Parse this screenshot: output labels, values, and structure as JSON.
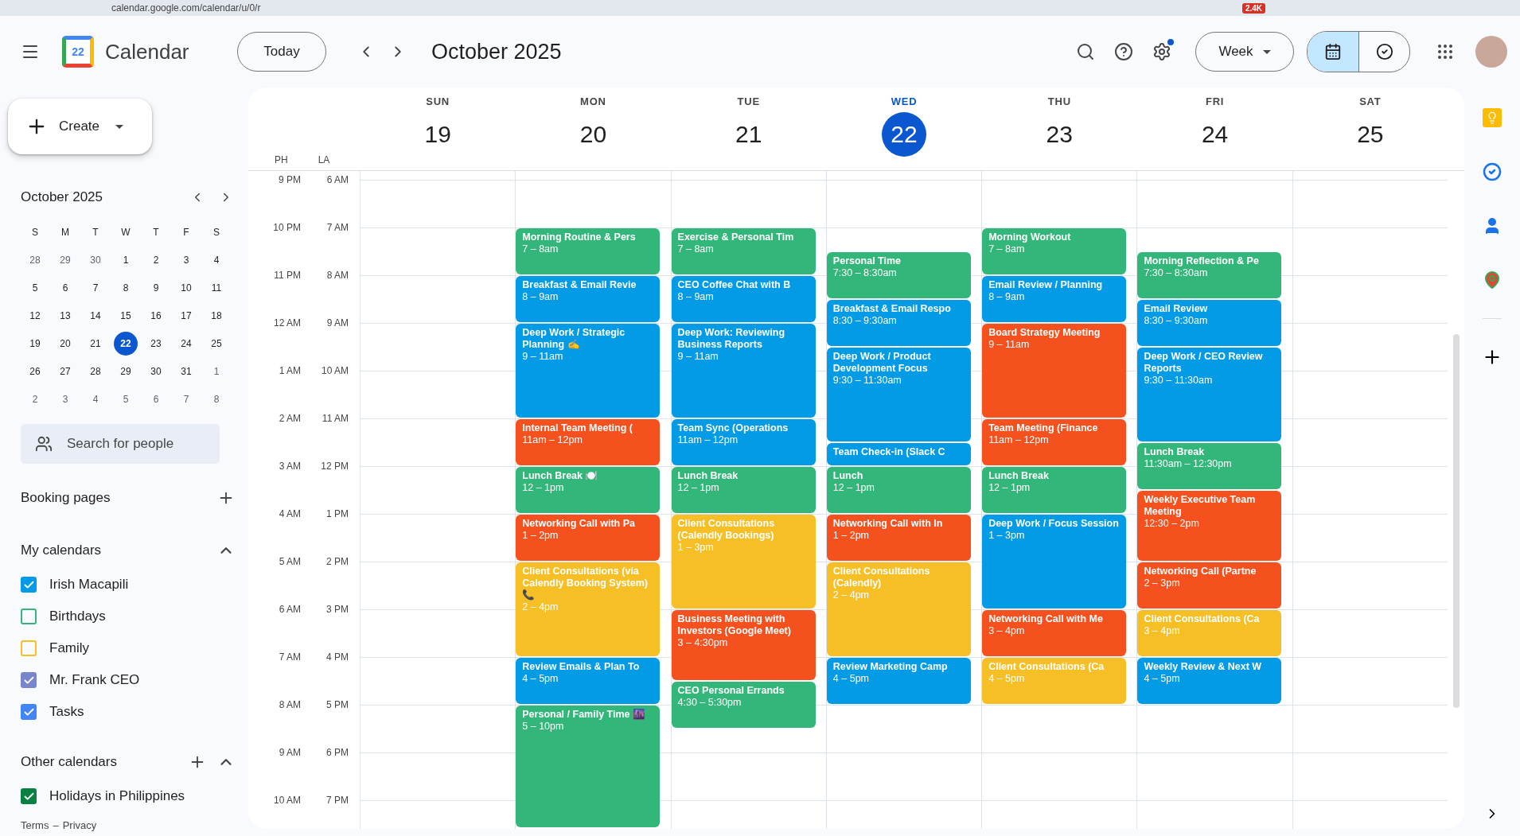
{
  "browser": {
    "url": "calendar.google.com/calendar/u/0/r",
    "badge": "2.4K"
  },
  "header": {
    "logo_text": "22",
    "app_name": "Calendar",
    "today_button": "Today",
    "period": "October 2025",
    "settings_badge": true,
    "view_button": "Week",
    "view_toggle": [
      {
        "kind": "calendar",
        "selected": true
      },
      {
        "kind": "tasks",
        "selected": false
      }
    ]
  },
  "sidebar": {
    "create": "Create",
    "mini_calendar": {
      "title": "October 2025",
      "weekdays": [
        "S",
        "M",
        "T",
        "W",
        "T",
        "F",
        "S"
      ],
      "weeks": [
        [
          {
            "day": "28",
            "outside": true,
            "selected": false
          },
          {
            "day": "29",
            "outside": true,
            "selected": false
          },
          {
            "day": "30",
            "outside": true,
            "selected": false
          },
          {
            "day": "1",
            "outside": false,
            "selected": false
          },
          {
            "day": "2",
            "outside": false,
            "selected": false
          },
          {
            "day": "3",
            "outside": false,
            "selected": false
          },
          {
            "day": "4",
            "outside": false,
            "selected": false
          }
        ],
        [
          {
            "day": "5",
            "outside": false,
            "selected": false
          },
          {
            "day": "6",
            "outside": false,
            "selected": false
          },
          {
            "day": "7",
            "outside": false,
            "selected": false
          },
          {
            "day": "8",
            "outside": false,
            "selected": false
          },
          {
            "day": "9",
            "outside": false,
            "selected": false
          },
          {
            "day": "10",
            "outside": false,
            "selected": false
          },
          {
            "day": "11",
            "outside": false,
            "selected": false
          }
        ],
        [
          {
            "day": "12",
            "outside": false,
            "selected": false
          },
          {
            "day": "13",
            "outside": false,
            "selected": false
          },
          {
            "day": "14",
            "outside": false,
            "selected": false
          },
          {
            "day": "15",
            "outside": false,
            "selected": false
          },
          {
            "day": "16",
            "outside": false,
            "selected": false
          },
          {
            "day": "17",
            "outside": false,
            "selected": false
          },
          {
            "day": "18",
            "outside": false,
            "selected": false
          }
        ],
        [
          {
            "day": "19",
            "outside": false,
            "selected": false
          },
          {
            "day": "20",
            "outside": false,
            "selected": false
          },
          {
            "day": "21",
            "outside": false,
            "selected": false
          },
          {
            "day": "22",
            "outside": false,
            "selected": true
          },
          {
            "day": "23",
            "outside": false,
            "selected": false
          },
          {
            "day": "24",
            "outside": false,
            "selected": false
          },
          {
            "day": "25",
            "outside": false,
            "selected": false
          }
        ],
        [
          {
            "day": "26",
            "outside": false,
            "selected": false
          },
          {
            "day": "27",
            "outside": false,
            "selected": false
          },
          {
            "day": "28",
            "outside": false,
            "selected": false
          },
          {
            "day": "29",
            "outside": false,
            "selected": false
          },
          {
            "day": "30",
            "outside": false,
            "selected": false
          },
          {
            "day": "31",
            "outside": false,
            "selected": false
          },
          {
            "day": "1",
            "outside": true,
            "selected": false
          }
        ],
        [
          {
            "day": "2",
            "outside": true,
            "selected": false
          },
          {
            "day": "3",
            "outside": true,
            "selected": false
          },
          {
            "day": "4",
            "outside": true,
            "selected": false
          },
          {
            "day": "5",
            "outside": true,
            "selected": false
          },
          {
            "day": "6",
            "outside": true,
            "selected": false
          },
          {
            "day": "7",
            "outside": true,
            "selected": false
          },
          {
            "day": "8",
            "outside": true,
            "selected": false
          }
        ]
      ]
    },
    "people_search": {
      "placeholder": "Search for people"
    },
    "booking_pages": "Booking pages",
    "my_calendars": {
      "title": "My calendars",
      "expanded": true,
      "items": [
        {
          "name": "Irish Macapili",
          "checked": true,
          "color": "#039be5"
        },
        {
          "name": "Birthdays",
          "checked": false,
          "color": "#33b679"
        },
        {
          "name": "Family",
          "checked": false,
          "color": "#f6bf26"
        },
        {
          "name": "Mr. Frank CEO",
          "checked": true,
          "color": "#7986cb"
        },
        {
          "name": "Tasks",
          "checked": true,
          "color": "#4285f4"
        }
      ]
    },
    "other_calendars": {
      "title": "Other calendars",
      "expanded": true,
      "items": [
        {
          "name": "Holidays in Philippines",
          "checked": true,
          "color": "#0b8043"
        }
      ]
    },
    "footer": {
      "links": [
        "Terms",
        "Privacy"
      ],
      "separator": "–"
    }
  },
  "week": {
    "timezones": [
      "PH",
      "LA"
    ],
    "hours": [
      {
        "ph": "9 PM",
        "la": "6 AM"
      },
      {
        "ph": "10 PM",
        "la": "7 AM"
      },
      {
        "ph": "11 PM",
        "la": "8 AM"
      },
      {
        "ph": "12 AM",
        "la": "9 AM"
      },
      {
        "ph": "1 AM",
        "la": "10 AM"
      },
      {
        "ph": "2 AM",
        "la": "11 AM"
      },
      {
        "ph": "3 AM",
        "la": "12 PM"
      },
      {
        "ph": "4 AM",
        "la": "1 PM"
      },
      {
        "ph": "5 AM",
        "la": "2 PM"
      },
      {
        "ph": "6 AM",
        "la": "3 PM"
      },
      {
        "ph": "7 AM",
        "la": "4 PM"
      },
      {
        "ph": "8 AM",
        "la": "5 PM"
      },
      {
        "ph": "9 AM",
        "la": "6 PM"
      },
      {
        "ph": "10 AM",
        "la": "7 PM"
      }
    ],
    "days": [
      {
        "name": "SUN",
        "date": "19",
        "today": false
      },
      {
        "name": "MON",
        "date": "20",
        "today": false,
        "events": [
          {
            "title": "Morning Routine & Pers",
            "time": "7 – 8am",
            "color": "#33b679"
          },
          {
            "title": "Breakfast & Email Revie",
            "time": "8 – 9am",
            "color": "#039be5"
          },
          {
            "title": "Deep Work / Strategic Planning ✍️",
            "time": "9 – 11am",
            "color": "#039be5"
          },
          {
            "title": "Internal Team Meeting (",
            "time": "11am – 12pm",
            "color": "#f4511e"
          },
          {
            "title": "Lunch Break 🍽️",
            "time": "12 – 1pm",
            "color": "#33b679"
          },
          {
            "title": "Networking Call with Pa",
            "time": "1 – 2pm",
            "color": "#f4511e"
          },
          {
            "title": "Client Consultations (via Calendly Booking System) 📞",
            "time": "2 – 4pm",
            "color": "#f6bf26"
          },
          {
            "title": "Review Emails & Plan To",
            "time": "4 – 5pm",
            "color": "#039be5"
          },
          {
            "title": "Personal / Family Time 🌆",
            "time": "5 – 10pm",
            "color": "#33b679"
          }
        ]
      },
      {
        "name": "TUE",
        "date": "21",
        "today": false,
        "events": [
          {
            "title": "Exercise & Personal Tim",
            "time": "7 – 8am",
            "color": "#33b679"
          },
          {
            "title": "CEO Coffee Chat with B",
            "time": "8 – 9am",
            "color": "#039be5"
          },
          {
            "title": "Deep Work: Reviewing Business Reports",
            "time": "9 – 11am",
            "color": "#039be5"
          },
          {
            "title": "Team Sync (Operations",
            "time": "11am – 12pm",
            "color": "#039be5"
          },
          {
            "title": "Lunch Break",
            "time": "12 – 1pm",
            "color": "#33b679"
          },
          {
            "title": "Client Consultations (Calendly Bookings)",
            "time": "1 – 3pm",
            "color": "#f6bf26"
          },
          {
            "title": "Business Meeting with Investors (Google Meet)",
            "time": "3 – 4:30pm",
            "color": "#f4511e"
          },
          {
            "title": "CEO Personal Errands",
            "time": "4:30 – 5:30pm",
            "color": "#33b679"
          }
        ]
      },
      {
        "name": "WED",
        "date": "22",
        "today": true,
        "events": [
          {
            "title": "Personal Time",
            "time": "7:30 – 8:30am",
            "color": "#33b679"
          },
          {
            "title": "Breakfast & Email Respo",
            "time": "8:30 – 9:30am",
            "color": "#039be5"
          },
          {
            "title": "Deep Work / Product Development Focus",
            "time": "9:30 – 11:30am",
            "color": "#039be5"
          },
          {
            "title": "Team Check-in (Slack C",
            "color": "#039be5"
          },
          {
            "title": "Lunch",
            "time": "12 – 1pm",
            "color": "#33b679"
          },
          {
            "title": "Networking Call with In",
            "time": "1 – 2pm",
            "color": "#f4511e"
          },
          {
            "title": "Client Consultations (Calendly)",
            "time": "2 – 4pm",
            "color": "#f6bf26"
          },
          {
            "title": "Review Marketing Camp",
            "time": "4 – 5pm",
            "color": "#039be5"
          }
        ]
      },
      {
        "name": "THU",
        "date": "23",
        "today": false,
        "events": [
          {
            "title": "Morning Workout",
            "time": "7 – 8am",
            "color": "#33b679"
          },
          {
            "title": "Email Review / Planning",
            "time": "8 – 9am",
            "color": "#039be5"
          },
          {
            "title": "Board Strategy Meeting",
            "time": "9 – 11am",
            "color": "#f4511e"
          },
          {
            "title": "Team Meeting (Finance",
            "time": "11am – 12pm",
            "color": "#f4511e"
          },
          {
            "title": "Lunch Break",
            "time": "12 – 1pm",
            "color": "#33b679"
          },
          {
            "title": "Deep Work / Focus Session",
            "time": "1 – 3pm",
            "color": "#039be5"
          },
          {
            "title": "Networking Call with Me",
            "time": "3 – 4pm",
            "color": "#f4511e"
          },
          {
            "title": "Client Consultations (Ca",
            "time": "4 – 5pm",
            "color": "#f6bf26"
          }
        ]
      },
      {
        "name": "FRI",
        "date": "24",
        "today": false,
        "events": [
          {
            "title": "Morning Reflection & Pe",
            "time": "7:30 – 8:30am",
            "color": "#33b679"
          },
          {
            "title": "Email Review",
            "time": "8:30 – 9:30am",
            "color": "#039be5"
          },
          {
            "title": "Deep Work / CEO Review Reports",
            "time": "9:30 – 11:30am",
            "color": "#039be5"
          },
          {
            "title": "Lunch Break",
            "time": "11:30am – 12:30pm",
            "color": "#33b679"
          },
          {
            "title": "Weekly Executive Team Meeting",
            "time": "12:30 – 2pm",
            "color": "#f4511e"
          },
          {
            "title": "Networking Call (Partne",
            "time": "2 – 3pm",
            "color": "#f4511e"
          },
          {
            "title": "Client Consultations (Ca",
            "time": "3 – 4pm",
            "color": "#f6bf26"
          },
          {
            "title": "Weekly Review & Next W",
            "time": "4 – 5pm",
            "color": "#039be5"
          }
        ]
      },
      {
        "name": "SAT",
        "date": "25",
        "today": false
      }
    ]
  }
}
